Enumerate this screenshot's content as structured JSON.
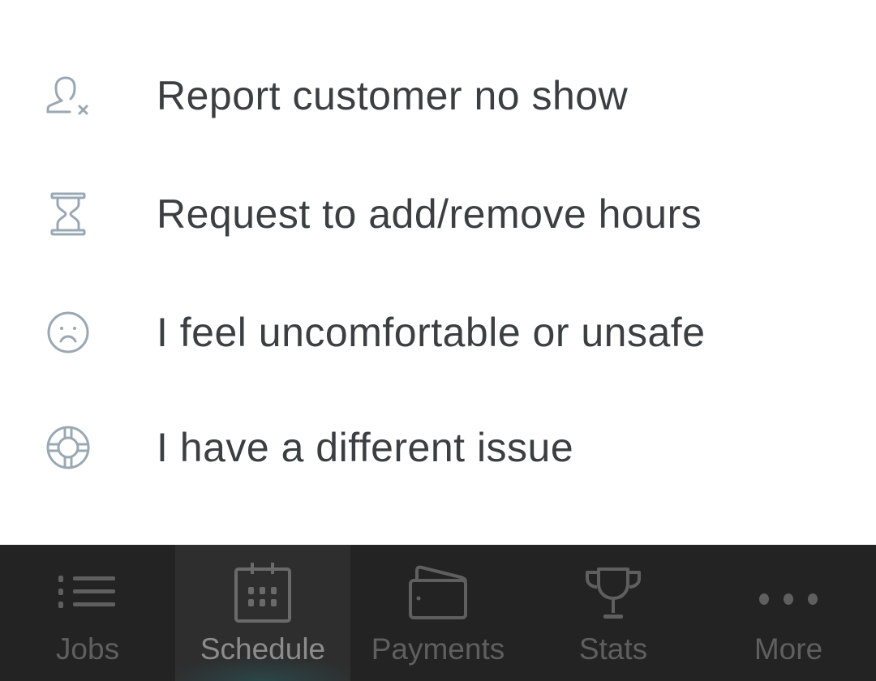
{
  "menu": {
    "items": [
      {
        "label": "Report customer no show",
        "icon": "user-x-icon"
      },
      {
        "label": "Request to add/remove hours",
        "icon": "hourglass-icon"
      },
      {
        "label": "I feel uncomfortable or unsafe",
        "icon": "sad-face-icon"
      },
      {
        "label": "I have a different issue",
        "icon": "lifebuoy-icon"
      }
    ]
  },
  "tabbar": {
    "selected": "Schedule",
    "tabs": [
      {
        "label": "Jobs",
        "icon": "list-icon"
      },
      {
        "label": "Schedule",
        "icon": "calendar-icon"
      },
      {
        "label": "Payments",
        "icon": "wallet-icon"
      },
      {
        "label": "Stats",
        "icon": "trophy-icon"
      },
      {
        "label": "More",
        "icon": "more-dots-icon"
      }
    ]
  },
  "colors": {
    "icon": "#9aa8b3",
    "text": "#3c3f42",
    "tabbar": "#232323"
  }
}
